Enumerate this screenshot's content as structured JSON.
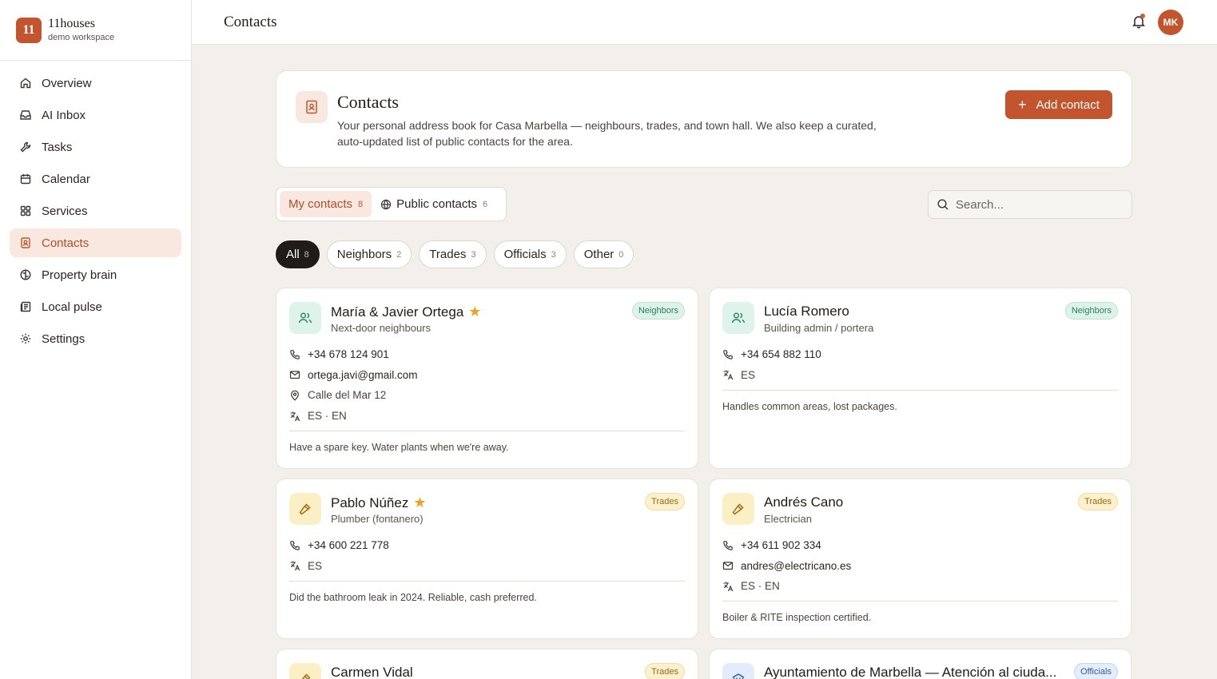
{
  "brand": {
    "logo": "11",
    "name": "11houses",
    "sub": "demo workspace"
  },
  "nav": [
    {
      "label": "Overview",
      "icon": "home-icon"
    },
    {
      "label": "AI Inbox",
      "icon": "inbox-icon"
    },
    {
      "label": "Tasks",
      "icon": "wrench-icon"
    },
    {
      "label": "Calendar",
      "icon": "calendar-icon"
    },
    {
      "label": "Services",
      "icon": "grid-icon"
    },
    {
      "label": "Contacts",
      "icon": "contacts-icon",
      "active": true
    },
    {
      "label": "Property brain",
      "icon": "brain-icon"
    },
    {
      "label": "Local pulse",
      "icon": "newspaper-icon"
    },
    {
      "label": "Settings",
      "icon": "gear-icon"
    }
  ],
  "topbar": {
    "title": "Contacts",
    "avatar": "MK"
  },
  "header": {
    "title": "Contacts",
    "description": "Your personal address book for Casa Marbella — neighbours, trades, and town hall. We also keep a curated, auto-updated list of public contacts for the area.",
    "add_label": "Add contact"
  },
  "tabs": [
    {
      "label": "My contacts",
      "count": "8",
      "active": true
    },
    {
      "label": "Public contacts",
      "count": "6"
    }
  ],
  "search": {
    "placeholder": "Search..."
  },
  "filters": [
    {
      "label": "All",
      "count": "8",
      "active": true
    },
    {
      "label": "Neighbors",
      "count": "2"
    },
    {
      "label": "Trades",
      "count": "3"
    },
    {
      "label": "Officials",
      "count": "3"
    },
    {
      "label": "Other",
      "count": "0"
    }
  ],
  "contacts": [
    {
      "name": "María & Javier Ortega",
      "role": "Next-door neighbours",
      "badge": "Neighbors",
      "starred": true,
      "phone": "+34 678 124 901",
      "email": "ortega.javi@gmail.com",
      "address": "Calle del Mar 12",
      "languages": "ES · EN",
      "note": "Have a spare key. Water plants when we're away."
    },
    {
      "name": "Lucía Romero",
      "role": "Building admin / portera",
      "badge": "Neighbors",
      "starred": false,
      "phone": "+34 654 882 110",
      "languages": "ES",
      "note": "Handles common areas, lost packages."
    },
    {
      "name": "Pablo Núñez",
      "role": "Plumber (fontanero)",
      "badge": "Trades",
      "starred": true,
      "phone": "+34 600 221 778",
      "languages": "ES",
      "note": "Did the bathroom leak in 2024. Reliable, cash preferred."
    },
    {
      "name": "Andrés Cano",
      "role": "Electrician",
      "badge": "Trades",
      "starred": false,
      "phone": "+34 611 902 334",
      "email": "andres@electricano.es",
      "languages": "ES · EN",
      "note": "Boiler & RITE inspection certified."
    },
    {
      "name": "Carmen Vidal",
      "badge": "Trades"
    },
    {
      "name": "Ayuntamiento de Marbella — Atención al ciuda...",
      "badge": "Officials"
    }
  ],
  "colors": {
    "accent": "#c2552d",
    "accent_bg": "#f8e8e0",
    "page_bg": "#f3f0eb"
  }
}
